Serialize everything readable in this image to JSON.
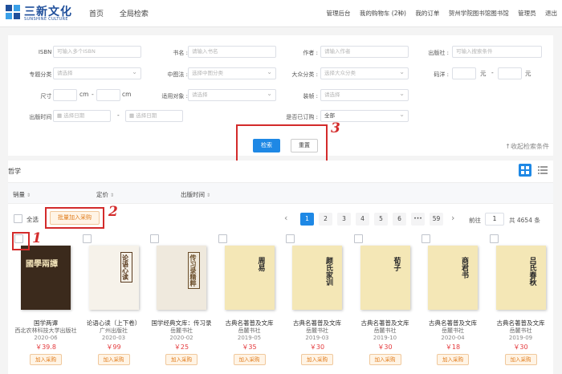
{
  "brand": {
    "cn": "三新文化",
    "en": "SUNSHINE CULTURE",
    "color": "#1f4f9b"
  },
  "nav": {
    "home": "首页",
    "global_search": "全局检索"
  },
  "topbar": {
    "admin": "管理后台",
    "cart": "我的购物车 (2种)",
    "orders": "我的订单",
    "library": "贺州学院图书馆图书馆",
    "user": "管理员",
    "logout": "退出"
  },
  "filters": {
    "isbn": {
      "label": "ISBN :",
      "placeholder": "可输入多个ISBN"
    },
    "title": {
      "label": "书名 :",
      "placeholder": "请输入书名"
    },
    "author": {
      "label": "作者 :",
      "placeholder": "请输入作者"
    },
    "publisher": {
      "label": "出版社 :",
      "placeholder": "可输入搜索条件"
    },
    "topic": {
      "label": "专题分类 :",
      "placeholder": "请选择"
    },
    "clc": {
      "label": "中图法 :",
      "placeholder": "选择中图分类"
    },
    "popular": {
      "label": "大众分类 :",
      "placeholder": "选择大众分类"
    },
    "price": {
      "label": "码洋 :",
      "unit": "元",
      "dash": "-"
    },
    "size": {
      "label": "尺寸 :",
      "unit": "cm",
      "dash": "-"
    },
    "audience": {
      "label": "适用对象 :",
      "placeholder": "请选择"
    },
    "binding": {
      "label": "装帧 :",
      "placeholder": "请选择"
    },
    "pubdate": {
      "label": "出版时间 :",
      "placeholder": "选择日期",
      "dash": "-"
    },
    "ordered": {
      "label": "是否已订购 :",
      "value": "全部"
    }
  },
  "actions": {
    "search": "检索",
    "reset": "重置",
    "collapse": "↑收起检索条件"
  },
  "annotations": {
    "a1": "1",
    "a2": "2",
    "a3": "3",
    "color": "#d32b2b"
  },
  "results": {
    "title": "哲学",
    "sort": {
      "sales": "销量",
      "price": "定价",
      "pubtime": "出版时间",
      "arrow": "⇕"
    },
    "select_all": "全选",
    "batch_add": "批量加入采购",
    "pagination": {
      "pages": [
        "1",
        "2",
        "3",
        "4",
        "5",
        "6",
        "•••",
        "59"
      ],
      "prev": "‹",
      "next": "›",
      "goto": "前往",
      "current": "1",
      "total": "共 4654 条"
    }
  },
  "books": [
    {
      "title": "国学两谭",
      "publisher": "西北农林科技大学出版社",
      "date": "2020-06",
      "price": "￥39.8",
      "add": "加入采购",
      "cover_text": "國學兩譚"
    },
    {
      "title": "论语心读（上下卷）",
      "publisher": "广州出版社",
      "date": "2020-03",
      "price": "￥99",
      "add": "加入采购",
      "cover_text": "论语心读"
    },
    {
      "title": "国学经典文库：传习录",
      "publisher": "岳麓书社",
      "date": "2020-02",
      "price": "￥25",
      "add": "加入采购",
      "cover_text": "传习录精粹"
    },
    {
      "title": "古典名著普及文库",
      "publisher": "岳麓书社",
      "date": "2019-05",
      "price": "￥35",
      "add": "加入采购",
      "cover_text": "周易"
    },
    {
      "title": "古典名著普及文库",
      "publisher": "岳麓书社",
      "date": "2019-03",
      "price": "￥30",
      "add": "加入采购",
      "cover_text": "颜氏家训"
    },
    {
      "title": "古典名著普及文库",
      "publisher": "岳麓书社",
      "date": "2019-10",
      "price": "￥30",
      "add": "加入采购",
      "cover_text": "荀子"
    },
    {
      "title": "古典名著普及文库",
      "publisher": "岳麓书社",
      "date": "2020-04",
      "price": "￥18",
      "add": "加入采购",
      "cover_text": "商君书"
    },
    {
      "title": "古典名著普及文库",
      "publisher": "岳麓书社",
      "date": "2019-09",
      "price": "￥30",
      "add": "加入采购",
      "cover_text": "吕氏春秋"
    }
  ]
}
